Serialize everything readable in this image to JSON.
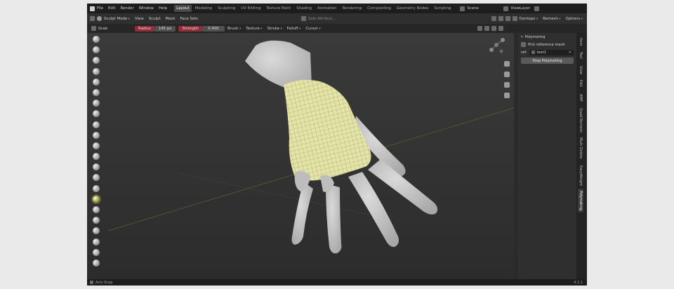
{
  "menu": [
    "File",
    "Edit",
    "Render",
    "Window",
    "Help"
  ],
  "workspaces": [
    "Layout",
    "Modeling",
    "Sculpting",
    "UV Editing",
    "Texture Paint",
    "Shading",
    "Animation",
    "Rendering",
    "Compositing",
    "Geometry Nodes",
    "Scripting"
  ],
  "active_workspace": "Layout",
  "scene": "Scene",
  "view_layer": "ViewLayer",
  "header": {
    "mode": "Sculpt Mode",
    "items": [
      "View",
      "Sculpt",
      "Mask",
      "Face Sets"
    ],
    "center": "Solo Attribut...",
    "right": [
      "Dyntopo",
      "Remesh",
      "Options"
    ]
  },
  "toolsettings": {
    "tool_name": "Grab",
    "radius_label": "Radius",
    "radius_value": "145 px",
    "strength_label": "Strength",
    "strength_value": "0.400",
    "menus": [
      "Brush",
      "Texture",
      "Stroke",
      "Falloff",
      "Cursor"
    ]
  },
  "panel": {
    "title": "Polymating",
    "pick_label": "Pick reference mesh",
    "ref_label": "ref:",
    "ref_value": "test1",
    "button": "Stop Polymating"
  },
  "sidebar_tabs": [
    "Item",
    "Tool",
    "View",
    "Edit",
    "AMP",
    "Quad Remesh",
    "Multi Delete",
    "EasyWeight",
    "Polymating"
  ],
  "active_tab": "Polymating",
  "status": {
    "left": "Axis Snap",
    "right": "4.1.1"
  },
  "colors": {
    "accent_red": "#8e2e36",
    "mesh_yellow": "#e4e3a8",
    "skin": "#cfcfcf"
  }
}
